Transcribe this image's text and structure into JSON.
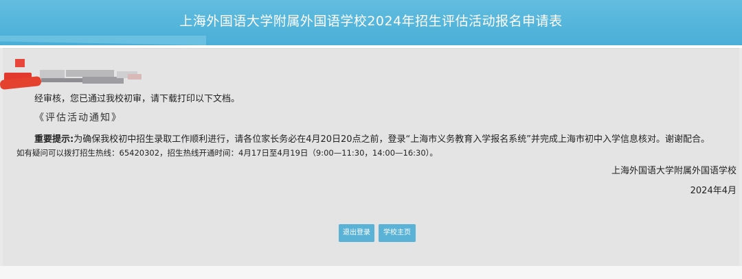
{
  "header": {
    "title": "上海外国语大学附属外国语学校2024年招生评估活动报名申请表"
  },
  "message": {
    "passed": "经审核，您已通过我校初审，请下载打印以下文档。",
    "notice_link": "《评估活动通知》",
    "important_label": "重要提示:",
    "important_text": "为确保我校初中招生录取工作顺利进行，请各位家长务必在4月20日20点之前，登录“上海市义务教育入学报名系统”并完成上海市初中入学信息核对。谢谢配合。",
    "hotline": "如有疑问可以拨打招生热线：65420302，招生热线开通时间：4月17日至4月19日（9:00—11:30，14:00—16:30）。"
  },
  "signature": {
    "school": "上海外国语大学附属外国语学校",
    "date": "2024年4月"
  },
  "buttons": {
    "logout": "退出登录",
    "home": "学校主页"
  },
  "colors": {
    "header": "#4aaed6",
    "button": "#5ab2d6",
    "panel": "#e4e4e5"
  }
}
